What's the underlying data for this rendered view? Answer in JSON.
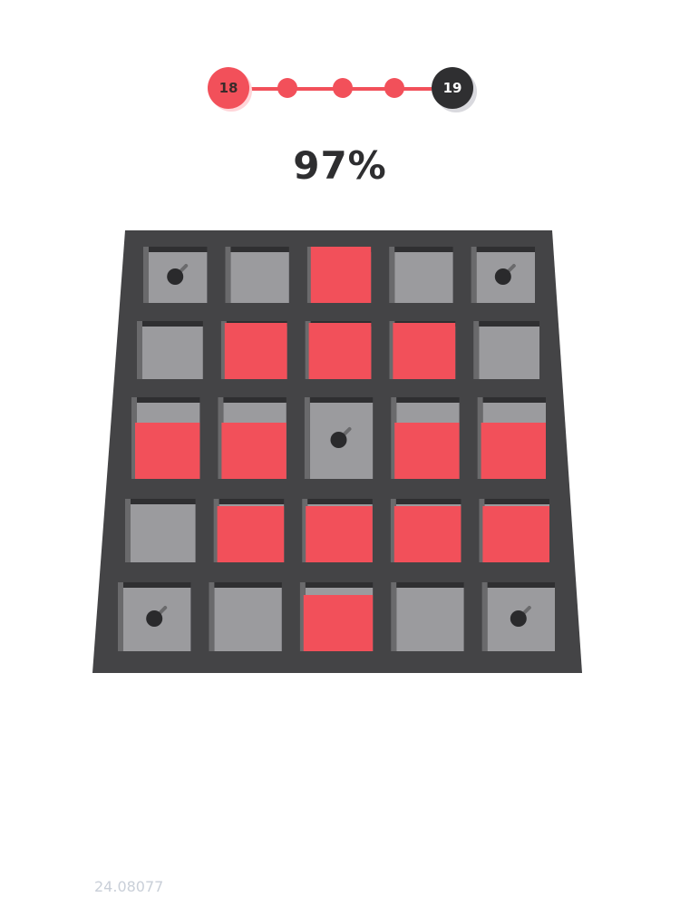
{
  "level": {
    "current": "18",
    "next": "19",
    "stages_total": 3,
    "stages_complete": 3
  },
  "progress_percent": "97%",
  "footer_text": "24.08077",
  "colors": {
    "accent": "#f2505a",
    "frame": "#444446",
    "cell": "#9b9b9e",
    "cell_shadow": "#6a6a6c",
    "dark": "#2f2f31"
  },
  "grid": {
    "rows": 5,
    "cols": 5,
    "cells": [
      [
        "ball",
        "empty",
        "block",
        "empty",
        "ball"
      ],
      [
        "empty",
        "block",
        "block",
        "block",
        "empty"
      ],
      [
        "block",
        "block",
        "ball",
        "block",
        "block"
      ],
      [
        "empty",
        "block",
        "block",
        "block",
        "block"
      ],
      [
        "ball",
        "empty",
        "block",
        "empty",
        "ball"
      ]
    ]
  }
}
